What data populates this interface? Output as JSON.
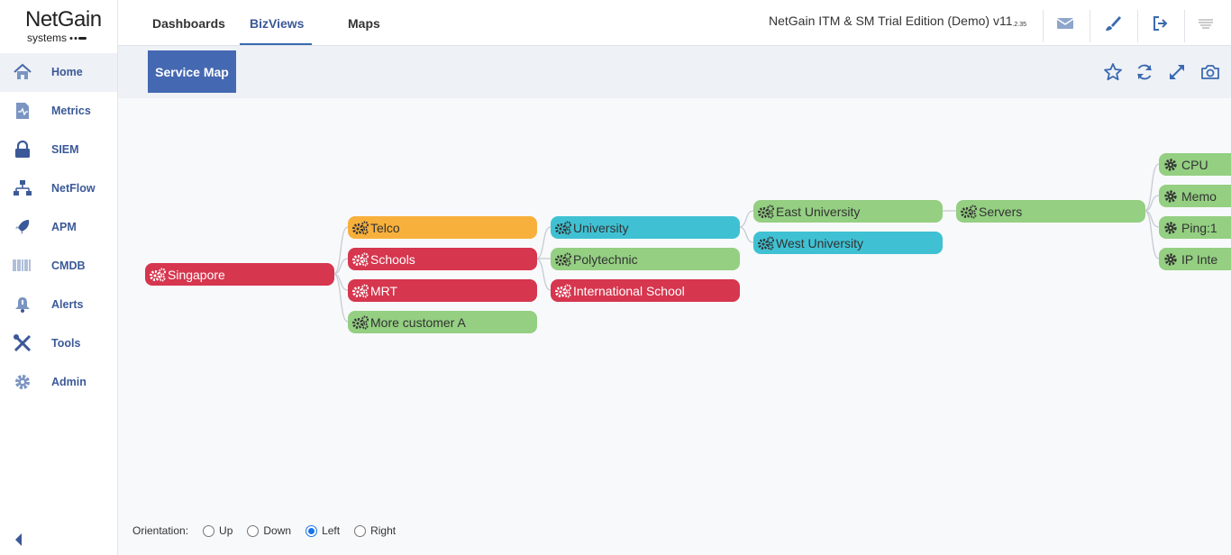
{
  "logo": {
    "brand": "NetGain",
    "sub": "systems"
  },
  "sidebar": {
    "items": [
      {
        "label": "Home",
        "icon": "home-icon",
        "active": true
      },
      {
        "label": "Metrics",
        "icon": "metrics-icon"
      },
      {
        "label": "SIEM",
        "icon": "lock-icon"
      },
      {
        "label": "NetFlow",
        "icon": "network-icon"
      },
      {
        "label": "APM",
        "icon": "rocket-icon"
      },
      {
        "label": "CMDB",
        "icon": "barcode-icon"
      },
      {
        "label": "Alerts",
        "icon": "bell-icon"
      },
      {
        "label": "Tools",
        "icon": "tools-icon"
      },
      {
        "label": "Admin",
        "icon": "gear-icon"
      }
    ]
  },
  "topbar": {
    "tabs": [
      {
        "label": "Dashboards"
      },
      {
        "label": "BizViews",
        "active": true
      },
      {
        "label": "Maps"
      }
    ],
    "edition": "NetGain ITM & SM Trial Edition (Demo) v11",
    "version_suffix": ".2.35",
    "icons": [
      "mail-icon",
      "brush-icon",
      "logout-icon",
      "user-avatar"
    ]
  },
  "page": {
    "title": "Service Map",
    "header_icons": [
      "star-icon",
      "refresh-icon",
      "expand-icon",
      "camera-icon"
    ]
  },
  "colors": {
    "red": "#d6364e",
    "orange": "#f8b03c",
    "green": "#94cf82",
    "cyan": "#3fc1d3",
    "accent": "#4568b2"
  },
  "map": {
    "nodes": {
      "singapore": {
        "label": "Singapore",
        "color": "red"
      },
      "telco": {
        "label": "Telco",
        "color": "orange"
      },
      "schools": {
        "label": "Schools",
        "color": "red"
      },
      "mrt": {
        "label": "MRT",
        "color": "red"
      },
      "more_customer_a": {
        "label": "More customer A",
        "color": "green"
      },
      "university": {
        "label": "University",
        "color": "cyan"
      },
      "polytechnic": {
        "label": "Polytechnic",
        "color": "green"
      },
      "international_school": {
        "label": "International School",
        "color": "red"
      },
      "east_university": {
        "label": "East University",
        "color": "green"
      },
      "west_university": {
        "label": "West University",
        "color": "cyan"
      },
      "servers": {
        "label": "Servers",
        "color": "green"
      },
      "cpu": {
        "label": "CPU",
        "color": "green"
      },
      "memory": {
        "label": "Memo",
        "color": "green"
      },
      "ping": {
        "label": "Ping:1",
        "color": "green"
      },
      "ip_interface": {
        "label": "IP Inte",
        "color": "green"
      }
    }
  },
  "orientation": {
    "label": "Orientation:",
    "options": [
      {
        "label": "Up",
        "checked": false
      },
      {
        "label": "Down",
        "checked": false
      },
      {
        "label": "Left",
        "checked": true
      },
      {
        "label": "Right",
        "checked": false
      }
    ]
  }
}
